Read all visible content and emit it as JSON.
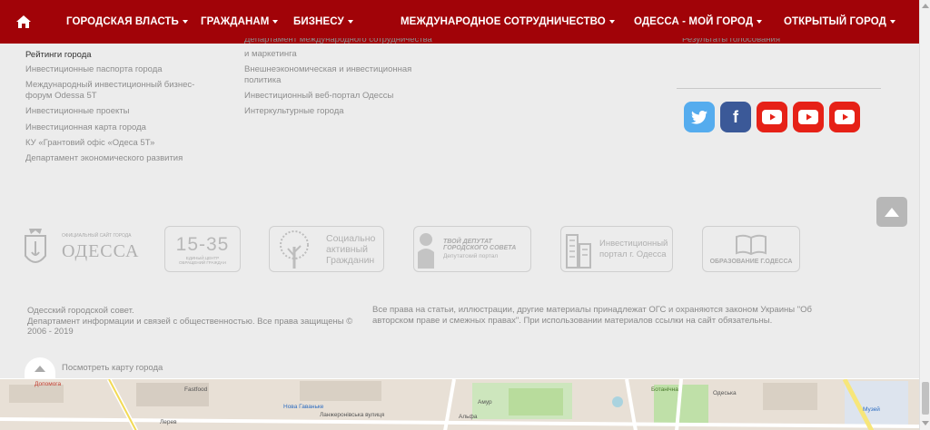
{
  "nav": {
    "items": [
      {
        "label": "ГОРОДСКАЯ ВЛАСТЬ"
      },
      {
        "label": "ГРАЖДАНАМ"
      },
      {
        "label": "БИЗНЕСУ"
      },
      {
        "label": "МЕЖДУНАРОДНОЕ СОТРУДНИЧЕСТВО"
      },
      {
        "label": "ОДЕССА - МОЙ ГОРОД"
      },
      {
        "label": "ОТКРЫТЫЙ ГОРОД"
      }
    ]
  },
  "business_links": [
    "Рейтинги города",
    "Инвестиционные паспорта города",
    "Международный инвестиционный бизнес-",
    "форум Odessa 5T",
    "Инвестиционные проекты",
    "Инвестиционная карта города",
    "КУ «Грантовий офіс «Одеса 5Т»",
    "Департамент экономического развития"
  ],
  "intl_links": [
    "Департамент международного сотрудничества",
    "и маркетинга",
    "Внешнеэкономическая и инвестиционная",
    "политика",
    "Инвестиционный веб-портал Одессы",
    "Интеркультурные города"
  ],
  "open_city_partial": "Результаты голосования",
  "social": [
    {
      "name": "twitter",
      "color": "#55acee"
    },
    {
      "name": "facebook",
      "color": "#3b5998"
    },
    {
      "name": "youtube",
      "color": "#e62117"
    },
    {
      "name": "youtube",
      "color": "#e62117"
    },
    {
      "name": "youtube",
      "color": "#e62117"
    }
  ],
  "logos": {
    "odessa_small": "ОФИЦИАЛЬНЫЙ САЙТ ГОРОДА",
    "odessa_big": "ОДЕССА",
    "center_num": "15-35",
    "center_sub1": "ЕДИНЫЙ ЦЕНТР",
    "center_sub2": "ОБРАЩЕНИЙ ГРАЖДАН",
    "social_active1": "Социально",
    "social_active2": "активный",
    "social_active3": "Гражданин",
    "deputy1": "ТВОЙ ДЕПУТАТ",
    "deputy2": "ГОРОДСКОГО СОВЕТА",
    "deputy3": "Депутатский портал",
    "invest1": "Инвестиционный",
    "invest2": "портал г. Одесса",
    "edu": "ОБРАЗОВАНИЕ Г.ОДЕССА"
  },
  "footer": {
    "left1": "Одесский городской совет.",
    "left2": "Департамент информации и связей с общественностью. Все права защищены ©",
    "left3": "2006 - 2019",
    "right1": "Все права на статьи, иллюстрации, другие материалы принадлежат ОГС и охраняются законом Украины \"Об",
    "right2": "авторском праве и смежных правах\". При использовании материалов ссылки на сайт обязательны."
  },
  "map": {
    "label": "Посмотреть карту города",
    "labels": [
      "Допомога",
      "Fastfood",
      "Нова Гаваньке",
      "Ланжеронівська вулиця",
      "Амур",
      "Альфа",
      "Ботанічна",
      "Одеська",
      "Музей",
      "Лерев"
    ]
  },
  "colors": {
    "nav_bg": "#a10308",
    "page_bg": "#ececec"
  }
}
